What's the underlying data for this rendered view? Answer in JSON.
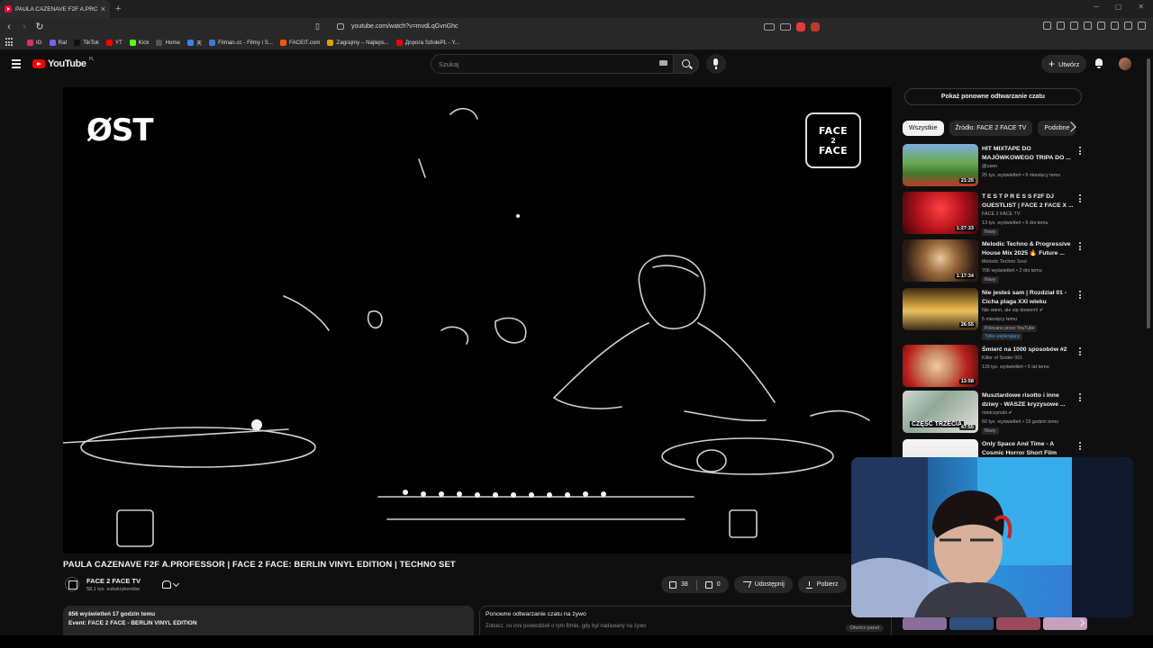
{
  "browser": {
    "tab_title": "PAULA CAZENAVE F2F A.PRO",
    "url": "youtube.com/watch?v=mvdLqGvnGhc",
    "bookmarks": [
      {
        "label": "IG",
        "color": "#e1306c"
      },
      {
        "label": "Rat",
        "color": "#7a5cff"
      },
      {
        "label": "TikTok",
        "color": "#111111"
      },
      {
        "label": "YT",
        "color": "#ff0000"
      },
      {
        "label": "Kick",
        "color": "#53fc18"
      },
      {
        "label": "Home",
        "color": "#555555"
      },
      {
        "label": "天",
        "color": "#3b82f6"
      },
      {
        "label": "Filman.cc - Filmy i S...",
        "color": "#3a7bd5"
      },
      {
        "label": "FACEIT.com",
        "color": "#ff5500"
      },
      {
        "label": "Zagrajmy – Najleps...",
        "color": "#e0a000"
      },
      {
        "label": "Дорога SzlolePL - Y...",
        "color": "#ff0000"
      }
    ]
  },
  "masthead": {
    "logo_text": "YouTube",
    "country": "PL",
    "search_placeholder": "Szukaj",
    "create_label": "Utwórz"
  },
  "video": {
    "overlay_left": "ØST",
    "overlay_right": [
      "FACE",
      "2",
      "FACE"
    ],
    "title": "PAULA CAZENAVE F2F A.PROFESSOR | FACE 2 FACE: BERLIN VINYL EDITION | TECHNO SET",
    "channel": "FACE 2 FACE TV",
    "subscribers": "58,1 tys. subskrybentów",
    "likes": "38",
    "dislikes": "0",
    "share_label": "Udostępnij",
    "download_label": "Pobierz",
    "views": "856 wyświetleń  17 godzin temu",
    "description_line": "Event: FACE 2 FACE - BERLIN VINYL EDITION"
  },
  "chat": {
    "show_replay_label": "Pokaż ponowne odtwarzanie czatu",
    "replay_title": "Ponowne odtwarzanie czatu na żywo",
    "replay_sub": "Zobacz, co inni powiedzieli o tym filmie, gdy był nadawany na żywo",
    "open_label": "Otwórz panel"
  },
  "chips": [
    "Wszystkie",
    "Źródło: FACE 2 FACE TV",
    "Podobne"
  ],
  "recommendations": [
    {
      "title": "HIT MIXTAPE DO MAJÓWKOWEGO TRIPA DO ...",
      "channel": "@usen",
      "meta": "25 tys. wyświetleń • 6 miesięcy temu",
      "duration": "21:25",
      "badge": ""
    },
    {
      "title": "T E S T P R E S S F2F DJ GUESTLIST | FACE 2 FACE X ...",
      "channel": "FACE 2 FACE TV",
      "meta": "13 tys. wyświetleń • 6 dni temu",
      "duration": "1:27:33",
      "badge": "Nowy"
    },
    {
      "title": "Melodic Techno & Progressive House Mix 2025 🔥 Future ...",
      "channel": "Melodic Techno Soul",
      "meta": "706 wyświetleń • 2 dni temu",
      "duration": "1:17:34",
      "badge": "Nowy"
    },
    {
      "title": "Nie jesteś sam | Rozdział 01 - Cicha plaga XXI wieku",
      "channel": "Nie wiem, ale się dowiem! ✔",
      "meta": "5 miesięcy temu",
      "duration": "26:55",
      "badge": "Polecane przez YouTube",
      "badge2": "Tylko wspierający"
    },
    {
      "title": "Śmierć na 1000 sposobów #2",
      "channel": "Killer of Smiler 001",
      "meta": "116 tys. wyświetleń • 5 lat temu",
      "duration": "13:58",
      "badge": ""
    },
    {
      "title": "Musztardowe risotto i inne dziwy - WASZE kryzysowe ...",
      "channel": "mietczynski ✔",
      "meta": "60 tys. wyświetleń • 19 godzin temu",
      "duration": "47:55",
      "badge": "Nowy",
      "thumb_text": "CZĘŚĆ TRZECIA"
    },
    {
      "title": "Only Space And Time - A Cosmic Horror Short Film",
      "channel": "",
      "meta": "",
      "duration": "",
      "badge": ""
    }
  ],
  "colors": {
    "bg": "#0f0f0f",
    "brand_red": "#ff0000",
    "chip_active": "#f1f1f1",
    "surface": "#272727"
  }
}
